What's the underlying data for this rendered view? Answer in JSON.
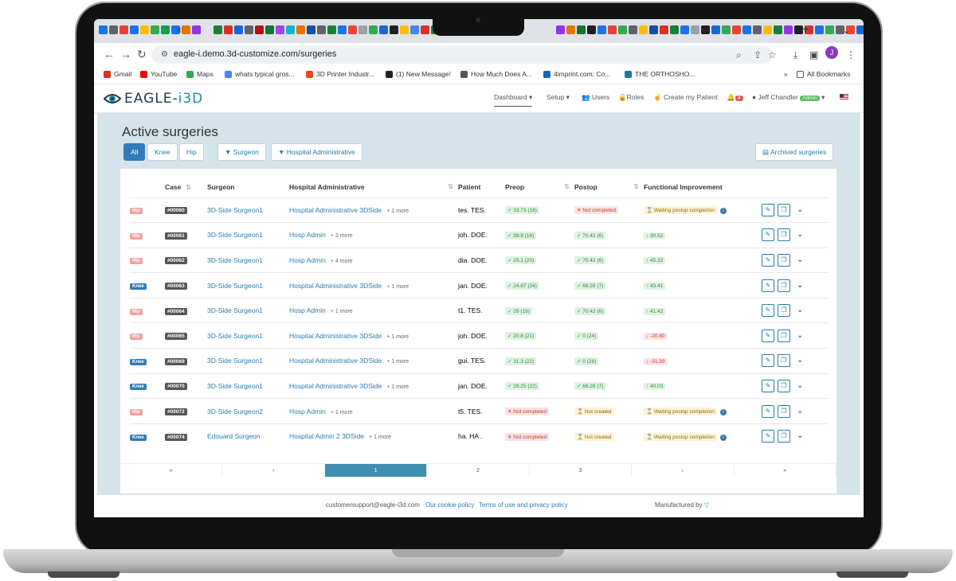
{
  "browser": {
    "url": "eagle-i.demo.3d-customize.com/surgeries",
    "profile_initial": "J",
    "bookmarks": [
      {
        "label": "Gmail",
        "color": "#d93025"
      },
      {
        "label": "YouTube",
        "color": "#ff0000"
      },
      {
        "label": "Maps",
        "color": "#34a853"
      },
      {
        "label": "whats typical gros...",
        "color": "#4285f4"
      },
      {
        "label": "3D Printer Industr...",
        "color": "#e64a19"
      },
      {
        "label": "(1) New Message!",
        "color": "#222222"
      },
      {
        "label": "How Much Does A...",
        "color": "#555555"
      },
      {
        "label": "4imprint.com: Co...",
        "color": "#1565c0"
      },
      {
        "label": "THE ORTHOSHO...",
        "color": "#21759b"
      }
    ],
    "all_bookmarks": "All Bookmarks"
  },
  "app": {
    "logo_main": "EAGLE-",
    "logo_accent": "i3D",
    "nav": {
      "dashboard": "Dashboard",
      "setup": "Setup",
      "users": "Users",
      "roles": "Roles",
      "create_patient": "Create my Patient",
      "notifications": "4",
      "user_name": "Jeff Chandler",
      "user_role": "Admin"
    }
  },
  "page": {
    "title": "Active surgeries",
    "filters": {
      "all": "All",
      "knee": "Knee",
      "hip": "Hip",
      "surgeon": "Surgeon",
      "hospital": "Hospital Administrative"
    },
    "archived": "Archived surgeries",
    "columns": {
      "case": "Case",
      "surgeon": "Surgeon",
      "hospital": "Hospital Administrative",
      "patient": "Patient",
      "preop": "Preop",
      "postop": "Postop",
      "improvement": "Functional Improvement"
    },
    "rows": [
      {
        "type": "Hip",
        "case": "#00060",
        "surgeon": "3D-Side Surgeon1",
        "hospital": "Hospital Administrative 3DSide",
        "more": "+ 1 more",
        "patient": "tes. TES.",
        "preop": "✓ 33.73 (18)",
        "preop_s": "ok",
        "postop": "✕ Not completed",
        "postop_s": "bad",
        "imp": "⌛ Waiting postop completion",
        "imp_s": "warn",
        "info": "i"
      },
      {
        "type": "Hip",
        "case": "#00061",
        "surgeon": "3D-Side Surgeon1",
        "hospital": "Hosp Admin",
        "more": "+ 2 more",
        "patient": "joh. DOE.",
        "preop": "✓ 39.9 (16)",
        "preop_s": "ok",
        "postop": "✓ 70.42 (6)",
        "postop_s": "ok",
        "imp": "↑ 30.52",
        "imp_s": "up",
        "info": ""
      },
      {
        "type": "Hip",
        "case": "#00062",
        "surgeon": "3D-Side Surgeon1",
        "hospital": "Hosp Admin",
        "more": "+ 4 more",
        "patient": "dia. DOE.",
        "preop": "✓ 25.1 (20)",
        "preop_s": "ok",
        "postop": "✓ 70.42 (6)",
        "postop_s": "ok",
        "imp": "↑ 45.32",
        "imp_s": "up",
        "info": ""
      },
      {
        "type": "Knee",
        "case": "#00063",
        "surgeon": "3D-Side Surgeon1",
        "hospital": "Hospital Administrative 3DSide",
        "more": "+ 1 more",
        "patient": "jan. DOE.",
        "preop": "✓ 24.87 (24)",
        "preop_s": "ok",
        "postop": "✓ 68.28 (7)",
        "postop_s": "ok",
        "imp": "↑ 43.41",
        "imp_s": "up",
        "info": ""
      },
      {
        "type": "Hip",
        "case": "#00064",
        "surgeon": "3D-Side Surgeon1",
        "hospital": "Hosp Admin",
        "more": "+ 1 more",
        "patient": "t1. TES.",
        "preop": "✓ 29 (19)",
        "preop_s": "ok",
        "postop": "✓ 70.42 (6)",
        "postop_s": "ok",
        "imp": "↑ 41.42",
        "imp_s": "up",
        "info": ""
      },
      {
        "type": "Hip",
        "case": "#00065",
        "surgeon": "3D-Side Surgeon1",
        "hospital": "Hospital Administrative 3DSide",
        "more": "+ 1 more",
        "patient": "joh. DOE.",
        "preop": "✓ 20.8 (21)",
        "preop_s": "ok",
        "postop": "✓ 0 (24)",
        "postop_s": "ok",
        "imp": "↓ -20.80",
        "imp_s": "down",
        "info": ""
      },
      {
        "type": "Knee",
        "case": "#00069",
        "surgeon": "3D-Side Surgeon1",
        "hospital": "Hospital Administrative 3DSide",
        "more": "+ 1 more",
        "patient": "gui. TES.",
        "preop": "✓ 31.3 (22)",
        "preop_s": "ok",
        "postop": "✓ 0 (28)",
        "postop_s": "ok",
        "imp": "↓ -31.30",
        "imp_s": "down",
        "info": ""
      },
      {
        "type": "Knee",
        "case": "#00070",
        "surgeon": "3D-Side Surgeon1",
        "hospital": "Hospital Administrative 3DSide",
        "more": "+ 1 more",
        "patient": "jan. DOE.",
        "preop": "✓ 28.25 (22)",
        "preop_s": "ok",
        "postop": "✓ 68.28 (7)",
        "postop_s": "ok",
        "imp": "↑ 40.03",
        "imp_s": "up",
        "info": ""
      },
      {
        "type": "Hip",
        "case": "#00072",
        "surgeon": "3D-Side Surgeon2",
        "hospital": "Hosp Admin",
        "more": "+ 1 more",
        "patient": "t5. TES.",
        "preop": "✕ Not completed",
        "preop_s": "bad",
        "postop": "⌛ Not created",
        "postop_s": "warn",
        "imp": "⌛ Waiting postop completion",
        "imp_s": "warn",
        "info": "i"
      },
      {
        "type": "Knee",
        "case": "#00074",
        "surgeon": "Edouard Surgeon",
        "hospital": "Hospital Admin 2 3DSide",
        "more": "+ 1 more",
        "patient": "ha. HA .",
        "preop": "✕ Not completed",
        "preop_s": "bad",
        "postop": "⌛ Not created",
        "postop_s": "warn",
        "imp": "⌛ Waiting postop completion",
        "imp_s": "warn",
        "info": "i"
      }
    ],
    "pager": [
      "«",
      "‹",
      "1",
      "2",
      "3",
      "›",
      "»"
    ],
    "pager_current": "1"
  },
  "footer": {
    "email": "customersupport@eagle-i3d.com",
    "cookie": "Our cookie policy",
    "terms": "Terms of use and privacy policy",
    "manufactured": "Manufactured by"
  }
}
